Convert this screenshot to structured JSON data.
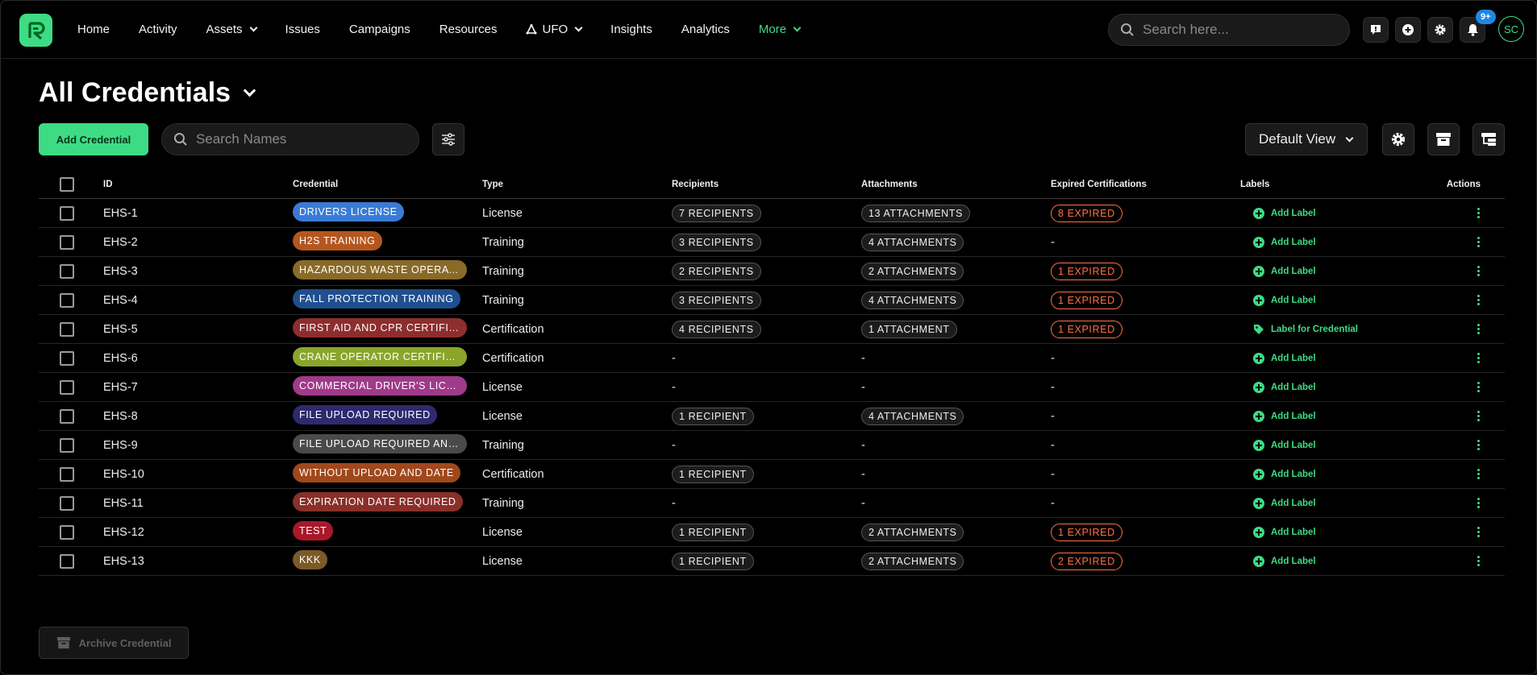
{
  "nav": {
    "links": [
      {
        "label": "Home",
        "dropdown": false
      },
      {
        "label": "Activity",
        "dropdown": false
      },
      {
        "label": "Assets",
        "dropdown": true
      },
      {
        "label": "Issues",
        "dropdown": false
      },
      {
        "label": "Campaigns",
        "dropdown": false
      },
      {
        "label": "Resources",
        "dropdown": false
      },
      {
        "label": "UFO",
        "dropdown": true
      },
      {
        "label": "Insights",
        "dropdown": false
      },
      {
        "label": "Analytics",
        "dropdown": false
      },
      {
        "label": "More",
        "dropdown": true
      }
    ],
    "search_placeholder": "Search here...",
    "notification_badge": "9+",
    "avatar_initials": "SC"
  },
  "page": {
    "title": "All Credentials",
    "add_button": "Add Credential",
    "search_placeholder": "Search Names",
    "view_select": "Default View",
    "archive_button": "Archive Credential"
  },
  "table": {
    "headers": {
      "id": "ID",
      "credential": "Credential",
      "type": "Type",
      "recipients": "Recipients",
      "attachments": "Attachments",
      "expired": "Expired Certifications",
      "labels": "Labels",
      "actions": "Actions"
    },
    "rows": [
      {
        "id": "EHS-1",
        "credential": "DRIVERS LICENSE",
        "color": "#3a7bd5",
        "type": "License",
        "recipients": "7 RECIPIENTS",
        "attachments": "13 ATTACHMENTS",
        "expired": "8 EXPIRED",
        "label": "Add Label",
        "label_kind": "add"
      },
      {
        "id": "EHS-2",
        "credential": "H2S TRAINING",
        "color": "#b5561f",
        "type": "Training",
        "recipients": "3 RECIPIENTS",
        "attachments": "4 ATTACHMENTS",
        "expired": "-",
        "label": "Add Label",
        "label_kind": "add"
      },
      {
        "id": "EHS-3",
        "credential": "HAZARDOUS WASTE OPERATI...",
        "color": "#8a6a28",
        "type": "Training",
        "recipients": "2 RECIPIENTS",
        "attachments": "2 ATTACHMENTS",
        "expired": "1 EXPIRED",
        "label": "Add Label",
        "label_kind": "add"
      },
      {
        "id": "EHS-4",
        "credential": "FALL PROTECTION TRAINING",
        "color": "#1f4f8f",
        "type": "Training",
        "recipients": "3 RECIPIENTS",
        "attachments": "4 ATTACHMENTS",
        "expired": "1 EXPIRED",
        "label": "Add Label",
        "label_kind": "add"
      },
      {
        "id": "EHS-5",
        "credential": "FIRST AID AND CPR CERTIFIC...",
        "color": "#8e2d2d",
        "type": "Certification",
        "recipients": "4 RECIPIENTS",
        "attachments": "1 ATTACHMENT",
        "expired": "1 EXPIRED",
        "label": "Label for Credential",
        "label_kind": "tag"
      },
      {
        "id": "EHS-6",
        "credential": "CRANE OPERATOR CERTIFICA...",
        "color": "#8aa52a",
        "type": "Certification",
        "recipients": "-",
        "attachments": "-",
        "expired": "-",
        "label": "Add Label",
        "label_kind": "add"
      },
      {
        "id": "EHS-7",
        "credential": "COMMERCIAL DRIVER'S LICEN...",
        "color": "#a03a8a",
        "type": "License",
        "recipients": "-",
        "attachments": "-",
        "expired": "-",
        "label": "Add Label",
        "label_kind": "add"
      },
      {
        "id": "EHS-8",
        "credential": "FILE UPLOAD REQUIRED",
        "color": "#2e2a6e",
        "type": "License",
        "recipients": "1 RECIPIENT",
        "attachments": "4 ATTACHMENTS",
        "expired": "-",
        "label": "Add Label",
        "label_kind": "add"
      },
      {
        "id": "EHS-9",
        "credential": "FILE UPLOAD REQUIRED AND ...",
        "color": "#4a4a4a",
        "type": "Training",
        "recipients": "-",
        "attachments": "-",
        "expired": "-",
        "label": "Add Label",
        "label_kind": "add"
      },
      {
        "id": "EHS-10",
        "credential": "WITHOUT UPLOAD AND DATE",
        "color": "#a0481c",
        "type": "Certification",
        "recipients": "1 RECIPIENT",
        "attachments": "-",
        "expired": "-",
        "label": "Add Label",
        "label_kind": "add"
      },
      {
        "id": "EHS-11",
        "credential": "EXPIRATION DATE REQUIRED",
        "color": "#8a2f2a",
        "type": "Training",
        "recipients": "-",
        "attachments": "-",
        "expired": "-",
        "label": "Add Label",
        "label_kind": "add"
      },
      {
        "id": "EHS-12",
        "credential": "TEST",
        "color": "#a8182a",
        "type": "License",
        "recipients": "1 RECIPIENT",
        "attachments": "2 ATTACHMENTS",
        "expired": "1 EXPIRED",
        "label": "Add Label",
        "label_kind": "add"
      },
      {
        "id": "EHS-13",
        "credential": "KKK",
        "color": "#7a5a28",
        "type": "License",
        "recipients": "1 RECIPIENT",
        "attachments": "2 ATTACHMENTS",
        "expired": "2 EXPIRED",
        "label": "Add Label",
        "label_kind": "add"
      }
    ]
  },
  "colors": {
    "accent": "#3ddc84",
    "expired": "#ff7043",
    "badge": "#1e88e5"
  }
}
